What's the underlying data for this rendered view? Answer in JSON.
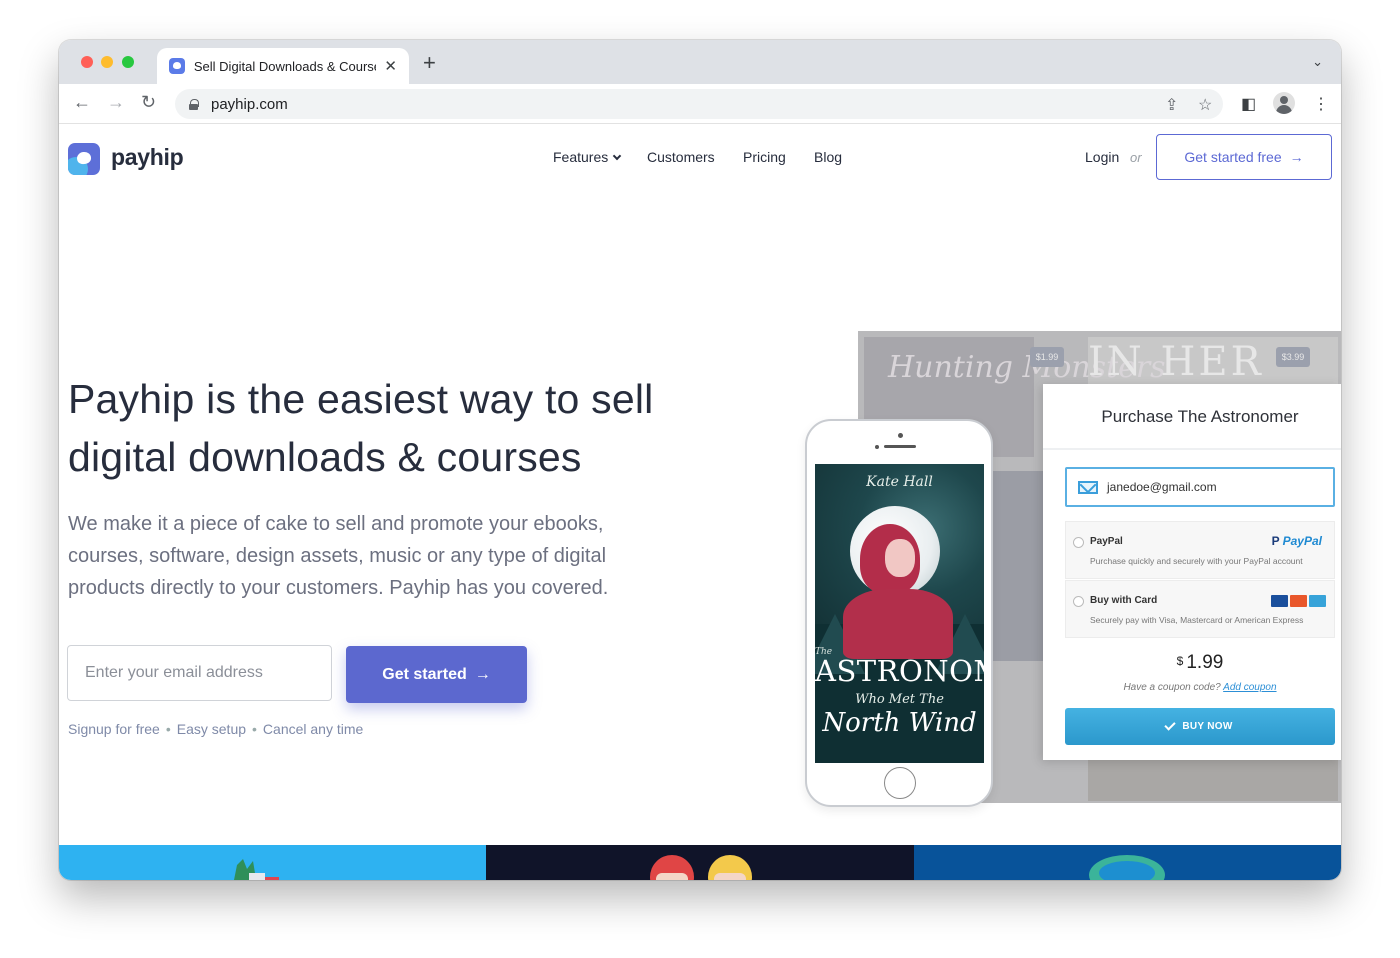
{
  "browser": {
    "tab_title": "Sell Digital Downloads & Courses",
    "url": "payhip.com"
  },
  "header": {
    "logo_text": "payhip",
    "nav": {
      "features": "Features",
      "customers": "Customers",
      "pricing": "Pricing",
      "blog": "Blog"
    },
    "login": "Login",
    "or": "or",
    "cta": "Get started free"
  },
  "hero": {
    "title": "Payhip is the easiest way to sell digital downloads & courses",
    "subtitle": "We make it a piece of cake to sell and promote your ebooks, courses, software, design assets, music or any type of digital products directly to your customers. Payhip has you covered.",
    "email_placeholder": "Enter your email address",
    "cta": "Get started",
    "notes": [
      "Signup for free",
      "Easy setup",
      "Cancel any time"
    ]
  },
  "mockup": {
    "bg_price_1": "$1.99",
    "bg_price_2": "$3.99",
    "bg_title_script": "Hunting Monsters",
    "bg_title_caps": "IN HER HE",
    "cover": {
      "author": "Kate Hall",
      "the": "The",
      "title": "ASTRONOMER",
      "subtitle": "Who Met The",
      "subtitle2": "North Wind"
    },
    "purchase": {
      "title": "Purchase The Astronomer",
      "email": "janedoe@gmail.com",
      "paypal_name": "PayPal",
      "paypal_logo": "PayPal",
      "paypal_desc": "Purchase quickly and securely with your PayPal account",
      "card_name": "Buy with Card",
      "card_desc": "Securely pay with Visa, Mastercard or American Express",
      "currency": "$",
      "price": "1.99",
      "coupon_text": "Have a coupon code?",
      "coupon_link": "Add coupon",
      "buy_label": "BUY NOW"
    }
  },
  "colors": {
    "brand": "#5c68cf",
    "band_1": "#2eb2f1",
    "band_2": "#101429",
    "band_3": "#08539a"
  }
}
